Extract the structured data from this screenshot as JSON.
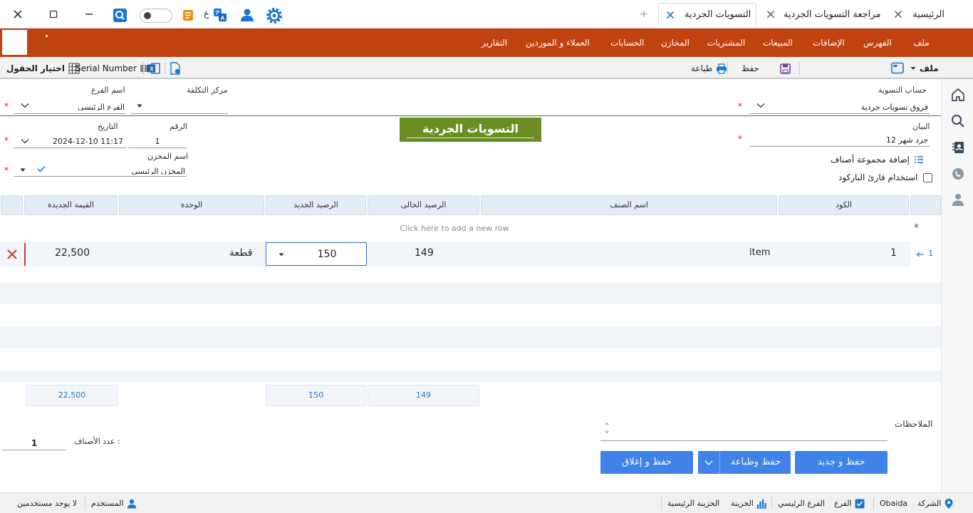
{
  "tabs": [
    {
      "label": "الرئيسية",
      "active": false
    },
    {
      "label": "مراجعة التسويات الجردية",
      "active": false
    },
    {
      "label": "التسويات الجردية",
      "active": true
    }
  ],
  "titlebar": {
    "lang_label": "ع"
  },
  "menu": {
    "items": [
      "ملف",
      "الفهرس",
      "الإضافات",
      "المبيعات",
      "المشتريات",
      "المخازن",
      "الحسابات",
      "العملاء و الموردين",
      "التقارير"
    ]
  },
  "toolbar": {
    "file_label": "ملف",
    "save_label": "حفظ",
    "print_label": "طباعة",
    "serial_label": "Serial Number",
    "choose_fields_label": "اختيار الحقول"
  },
  "form": {
    "account_label": "حساب التسوية",
    "account_value": "فروق تسويات جردية",
    "cost_center_label": "مركز التكلفة",
    "cost_center_value": "",
    "branch_label": "اسم الفرع",
    "branch_value": "الفرع الرئيسي",
    "statement_label": "البيان",
    "statement_value": "جرد شهر 12",
    "number_label": "الرقم",
    "number_value": "1",
    "date_label": "التاريخ",
    "date_value": "2024-12-10  11:17",
    "store_label": "اسم المخزن",
    "store_value": "المخزن الرئيسي",
    "add_group_label": "إضافة مجموعة أصناف",
    "barcode_label": "استخدام قارئ الباركود",
    "page_title": "التسويات الجردية"
  },
  "grid": {
    "headers": {
      "code": "الكود",
      "item_name": "اسم الصنف",
      "current_balance": "الرصيد الحالى",
      "new_balance": "الرصيد الجديد",
      "unit": "الوحدة",
      "new_value": "القيمة الجديدة"
    },
    "add_row_text": "Click here to add a new row",
    "rows": [
      {
        "index": "1",
        "code": "1",
        "item_name": "item",
        "current_balance": "149",
        "new_balance": "150",
        "unit": "قطعة",
        "new_value": "22,500"
      }
    ],
    "totals": {
      "current_balance": "149",
      "new_balance": "150",
      "new_value": "22,500"
    }
  },
  "notes": {
    "label": "الملاحظات",
    "value": ""
  },
  "items_count": {
    "label": "عدد الأصناف :",
    "value": "1"
  },
  "buttons": {
    "save_new": "حفظ و جديد",
    "save_print": "حفظ وطباعة",
    "save_close": "حفظ و إغلاق"
  },
  "status": {
    "company_label": "الشركة",
    "company_value": "Obaida",
    "branch_label": "الفرع",
    "branch_value": "الفرع الرئيسي",
    "treasury_label": "الخزينة",
    "treasury_value": "الخزينة الرئيسية",
    "user_label": "المستخدم",
    "users_value": "لا يوجد مستخدمين"
  },
  "colors": {
    "menu_bar": "#c0430f",
    "title_banner": "#6b8e23",
    "primary_button": "#3f82e8",
    "required_mark": "#d32020",
    "delete_icon": "#d9392b"
  }
}
